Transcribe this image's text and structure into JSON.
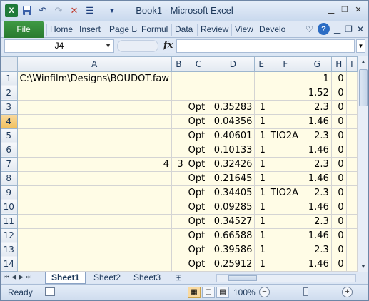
{
  "window": {
    "title": "Book1  -  Microsoft Excel"
  },
  "qat_icons": [
    "excel-app-icon",
    "save-icon",
    "undo-icon",
    "redo-icon",
    "customize-icon"
  ],
  "ribbon": {
    "file_label": "File",
    "tabs": [
      "Home",
      "Insert",
      "Page La",
      "Formul",
      "Data",
      "Review",
      "View",
      "Develo"
    ]
  },
  "formula_bar": {
    "name_box": "J4",
    "fx_label": "fx",
    "formula": ""
  },
  "columns": [
    "A",
    "B",
    "C",
    "D",
    "E",
    "F",
    "G",
    "H",
    "I"
  ],
  "selected_row": 4,
  "rows": [
    {
      "n": "1",
      "cells": [
        "C:\\Winfilm\\Designs\\BOUDOT.faw",
        "",
        "",
        "",
        "",
        "",
        "1",
        "0",
        ""
      ]
    },
    {
      "n": "2",
      "cells": [
        "",
        "",
        "",
        "",
        "",
        "",
        "1.52",
        "0",
        ""
      ]
    },
    {
      "n": "3",
      "cells": [
        "",
        "",
        "Opt",
        "0.35283",
        "1",
        "",
        "2.3",
        "0",
        ""
      ]
    },
    {
      "n": "4",
      "cells": [
        "",
        "",
        "Opt",
        "0.04356",
        "1",
        "",
        "1.46",
        "0",
        ""
      ]
    },
    {
      "n": "5",
      "cells": [
        "",
        "",
        "Opt",
        "0.40601",
        "1",
        "TIO2A",
        "2.3",
        "0",
        ""
      ]
    },
    {
      "n": "6",
      "cells": [
        "",
        "",
        "Opt",
        "0.10133",
        "1",
        "",
        "1.46",
        "0",
        ""
      ]
    },
    {
      "n": "7",
      "cells": [
        "4",
        "3",
        "Opt",
        "0.32426",
        "1",
        "",
        "2.3",
        "0",
        ""
      ]
    },
    {
      "n": "8",
      "cells": [
        "",
        "",
        "Opt",
        "0.21645",
        "1",
        "",
        "1.46",
        "0",
        ""
      ]
    },
    {
      "n": "9",
      "cells": [
        "",
        "",
        "Opt",
        "0.34405",
        "1",
        "TIO2A",
        "2.3",
        "0",
        ""
      ]
    },
    {
      "n": "10",
      "cells": [
        "",
        "",
        "Opt",
        "0.09285",
        "1",
        "",
        "1.46",
        "0",
        ""
      ]
    },
    {
      "n": "11",
      "cells": [
        "",
        "",
        "Opt",
        "0.34527",
        "1",
        "",
        "2.3",
        "0",
        ""
      ]
    },
    {
      "n": "12",
      "cells": [
        "",
        "",
        "Opt",
        "0.66588",
        "1",
        "",
        "1.46",
        "0",
        ""
      ]
    },
    {
      "n": "13",
      "cells": [
        "",
        "",
        "Opt",
        "0.39586",
        "1",
        "",
        "2.3",
        "0",
        ""
      ]
    },
    {
      "n": "14",
      "cells": [
        "",
        "",
        "Opt",
        "0.25912",
        "1",
        "",
        "1.46",
        "0",
        ""
      ]
    }
  ],
  "sheets": {
    "tabs": [
      "Sheet1",
      "Sheet2",
      "Sheet3"
    ],
    "active": "Sheet1"
  },
  "status": {
    "ready": "Ready",
    "zoom": "100%",
    "zoom_level": 1.0
  },
  "colors": {
    "file_tab": "#2a7b30",
    "cell_fill": "#fffce6",
    "selected_header": "#f1c15f"
  }
}
